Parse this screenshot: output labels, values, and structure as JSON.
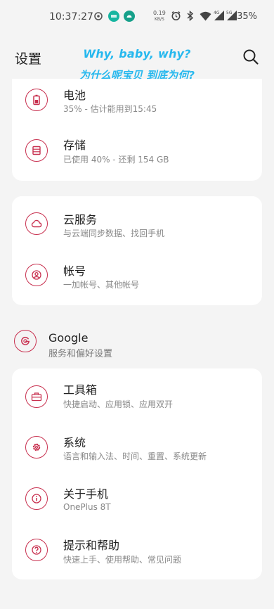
{
  "status_bar": {
    "time": "10:37:27",
    "net_speed_value": "0.19",
    "net_speed_unit": "KB/S",
    "signal1_label": "4G",
    "signal2_label": "5G",
    "battery_percent": "35%"
  },
  "header": {
    "title": "设置",
    "overlay_line1": "Why, baby, why?",
    "overlay_line2": "为什么呢宝贝 到底为何?"
  },
  "sections": {
    "battery": {
      "title": "电池",
      "subtitle": "35% - 估计能用到15:45"
    },
    "storage": {
      "title": "存储",
      "subtitle": "已使用 40% - 还剩 154 GB"
    },
    "cloud": {
      "title": "云服务",
      "subtitle": "与云端同步数据、找回手机"
    },
    "account": {
      "title": "帐号",
      "subtitle": "一加帐号、其他帐号"
    },
    "google": {
      "title": "Google",
      "subtitle": "服务和偏好设置"
    },
    "toolbox": {
      "title": "工具箱",
      "subtitle": "快捷启动、应用锁、应用双开"
    },
    "system": {
      "title": "系统",
      "subtitle": "语言和输入法、时间、重置、系统更新"
    },
    "about": {
      "title": "关于手机",
      "subtitle": "OnePlus 8T"
    },
    "help": {
      "title": "提示和帮助",
      "subtitle": "快速上手、使用帮助、常见问题"
    }
  },
  "colors": {
    "accent": "#c8304f",
    "overlay_text": "#26b8ee",
    "background": "#f4f4f4"
  }
}
